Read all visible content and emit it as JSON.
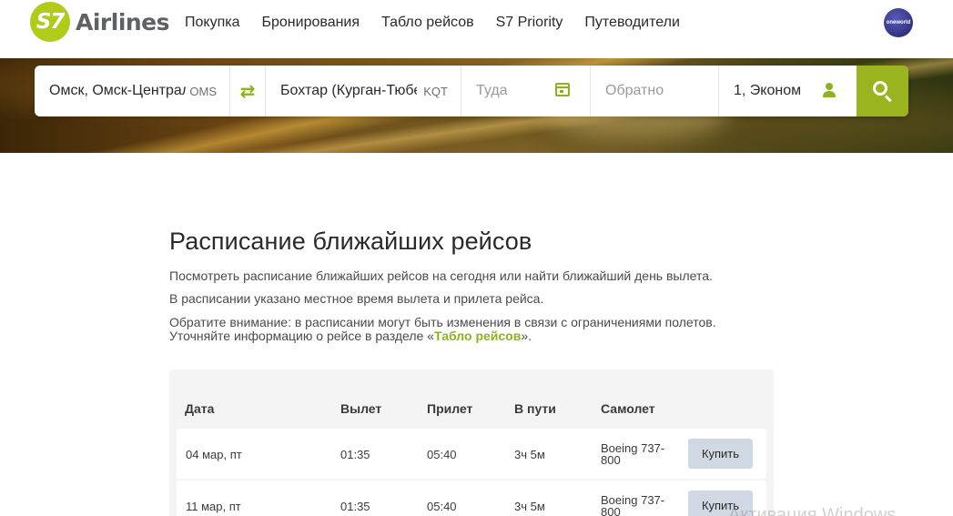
{
  "header": {
    "logo_mark": "S7",
    "logo_text": "Airlines",
    "nav": [
      "Покупка",
      "Бронирования",
      "Табло рейсов",
      "S7 Priority",
      "Путеводители"
    ],
    "alliance_badge": "oneworld"
  },
  "search": {
    "from_city": "Омск, Омск-Центральный",
    "from_code": "OMS",
    "to_city": "Бохтар (Курган-Тюбе)",
    "to_code": "KQT",
    "depart_placeholder": "Туда",
    "return_placeholder": "Обратно",
    "passengers": "1, Эконом",
    "icons": [
      "swap-icon",
      "calendar-icon",
      "user-icon",
      "search-icon"
    ]
  },
  "main": {
    "title": "Расписание ближайших рейсов",
    "p1": "Посмотреть расписание ближайших рейсов на сегодня или найти ближайший день вылета.",
    "p2": "В расписании указано местное время вылета и прилета рейса.",
    "p3_line1": "Обратите внимание: в расписании могут быть изменения в связи с ограничениями полетов.",
    "p3_line2_before": "Уточняйте информацию о рейсе в разделе «",
    "p3_link": "Табло рейсов",
    "p3_line2_after": "»."
  },
  "table": {
    "headers": {
      "date": "Дата",
      "depart": "Вылет",
      "arrive": "Прилет",
      "duration": "В пути",
      "plane": "Самолет"
    },
    "rows": [
      {
        "date": "04 мар, пт",
        "depart": "01:35",
        "arrive": "05:40",
        "duration": "3ч 5м",
        "plane": "Boeing 737-800",
        "action": "Купить"
      },
      {
        "date": "11 мар, пт",
        "depart": "01:35",
        "arrive": "05:40",
        "duration": "3ч 5м",
        "plane": "Boeing 737-800",
        "action": "Купить"
      }
    ]
  },
  "watermark": "Активация Windows",
  "colors": {
    "brand_green": "#9ab41f",
    "link_green": "#8cb31f",
    "buy_button": "#d0d9e3",
    "table_bg": "#f4f4f5"
  }
}
